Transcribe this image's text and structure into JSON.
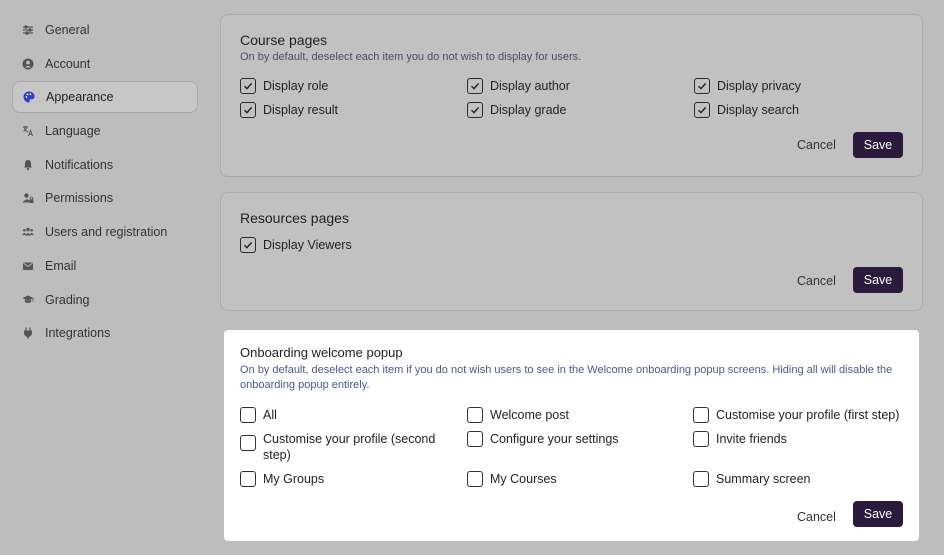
{
  "sidebar": {
    "items": [
      {
        "label": "General",
        "icon": "sliders-icon"
      },
      {
        "label": "Account",
        "icon": "user-circle-icon"
      },
      {
        "label": "Appearance",
        "icon": "palette-icon",
        "active": true
      },
      {
        "label": "Language",
        "icon": "translate-icon"
      },
      {
        "label": "Notifications",
        "icon": "bell-icon"
      },
      {
        "label": "Permissions",
        "icon": "user-lock-icon"
      },
      {
        "label": "Users and registration",
        "icon": "users-icon"
      },
      {
        "label": "Email",
        "icon": "envelope-icon"
      },
      {
        "label": "Grading",
        "icon": "graduation-cap-icon"
      },
      {
        "label": "Integrations",
        "icon": "plug-icon"
      }
    ]
  },
  "course_pages": {
    "title": "Course pages",
    "description": "On by default, deselect each item you do not wish to display for users.",
    "options": [
      {
        "label": "Display role",
        "checked": true
      },
      {
        "label": "Display author",
        "checked": true
      },
      {
        "label": "Display privacy",
        "checked": true
      },
      {
        "label": "Display result",
        "checked": true
      },
      {
        "label": "Display grade",
        "checked": true
      },
      {
        "label": "Display search",
        "checked": true
      }
    ],
    "cancel_label": "Cancel",
    "save_label": "Save"
  },
  "resources_pages": {
    "title": "Resources pages",
    "options": [
      {
        "label": "Display Viewers",
        "checked": true
      }
    ],
    "cancel_label": "Cancel",
    "save_label": "Save"
  },
  "onboarding": {
    "title": "Onboarding welcome popup",
    "description": "On by default, deselect each item if you do not wish users to see in the Welcome onboarding popup screens. Hiding all will disable the onboarding popup entirely.",
    "options": [
      {
        "label": "All",
        "checked": false
      },
      {
        "label": "Welcome post",
        "checked": false
      },
      {
        "label": "Customise your profile (first step)",
        "checked": false
      },
      {
        "label": "Customise your profile (second step)",
        "checked": false
      },
      {
        "label": "Configure your settings",
        "checked": false
      },
      {
        "label": "Invite friends",
        "checked": false
      },
      {
        "label": "My Groups",
        "checked": false
      },
      {
        "label": "My Courses",
        "checked": false
      },
      {
        "label": "Summary screen",
        "checked": false
      }
    ],
    "cancel_label": "Cancel",
    "save_label": "Save"
  },
  "colors": {
    "accent": "#2b1a3d",
    "overlay_background": "#bdbdbd",
    "description_text": "#4c5a86"
  }
}
